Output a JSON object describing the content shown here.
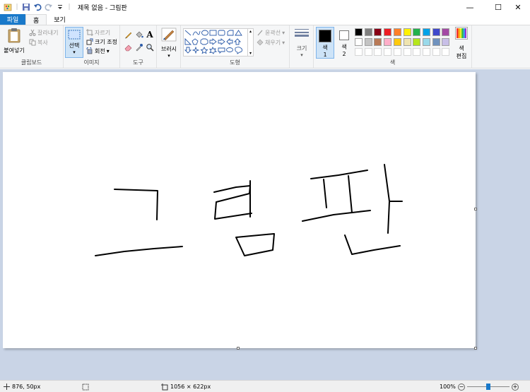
{
  "window": {
    "title": "제목 없음 - 그림판",
    "minimize_glyph": "—",
    "maximize_glyph": "☐",
    "close_glyph": "✕"
  },
  "quick_access": [
    "app-icon",
    "save-icon",
    "undo-icon",
    "redo-icon",
    "customize-icon"
  ],
  "tabs": [
    {
      "label": "파일"
    },
    {
      "label": "홈"
    },
    {
      "label": "보기"
    }
  ],
  "ribbon": {
    "clipboard": {
      "label": "클립보드",
      "paste": "붙여넣기",
      "cut": "잘라내기",
      "copy": "복사"
    },
    "image": {
      "label": "이미지",
      "select": "선택",
      "crop": "자르기",
      "resize": "크기 조정",
      "rotate": "회전"
    },
    "tools": {
      "label": "도구"
    },
    "brushes": {
      "label": "브러시"
    },
    "shapes": {
      "label": "도형",
      "outline": "윤곽선",
      "fill": "채우기"
    },
    "size": {
      "label": "크기"
    },
    "colors": {
      "label": "색",
      "color1": "색\n1",
      "color1_a": "색",
      "color1_b": "1",
      "color2_a": "색",
      "color2_b": "2",
      "edit_a": "색",
      "edit_b": "편집",
      "primary": "#000000",
      "secondary": "#ffffff",
      "palette_row1": [
        "#000000",
        "#7f7f7f",
        "#880015",
        "#ed1c24",
        "#ff7f27",
        "#fff200",
        "#22b14c",
        "#00a2e8",
        "#3f48cc",
        "#a349a4"
      ],
      "palette_row2": [
        "#ffffff",
        "#c3c3c3",
        "#b97a57",
        "#ffaec9",
        "#ffc90e",
        "#efe4b0",
        "#b5e61d",
        "#99d9ea",
        "#7092be",
        "#c8bfe7"
      ]
    }
  },
  "status": {
    "cursor_pos": "876, 50px",
    "image_size": "1056 × 622px",
    "zoom": "100%"
  }
}
